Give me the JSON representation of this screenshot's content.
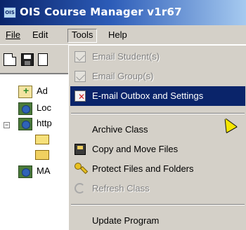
{
  "window": {
    "title": "OIS Course Manager v1r67",
    "icon": "OIS"
  },
  "menubar": {
    "items": [
      {
        "label": "File",
        "underline": "F"
      },
      {
        "label": "Edit",
        "underline": "E"
      },
      {
        "label": "Tools",
        "underline": "T"
      },
      {
        "label": "Help",
        "underline": "H"
      }
    ]
  },
  "tools_menu": {
    "items": [
      {
        "label": "Email Student(s)",
        "icon": "email-icon",
        "enabled": false
      },
      {
        "label": "Email Group(s)",
        "icon": "email-icon",
        "enabled": false
      },
      {
        "label": "E-mail Outbox and Settings",
        "icon": "outbox-icon",
        "enabled": true,
        "highlighted": true
      },
      {
        "label": "Archive Class",
        "icon": "",
        "enabled": true
      },
      {
        "label": "Copy and Move Files",
        "icon": "copy-files-icon",
        "enabled": true
      },
      {
        "label": "Protect Files and Folders",
        "icon": "key-icon",
        "enabled": true
      },
      {
        "label": "Refresh Class",
        "icon": "refresh-icon",
        "enabled": false
      },
      {
        "label": "Update Program",
        "icon": "",
        "enabled": true
      }
    ]
  },
  "tree": {
    "nodes": [
      {
        "label": "Ad"
      },
      {
        "label": "Loc"
      },
      {
        "label": "http"
      },
      {
        "label": "MA"
      }
    ]
  },
  "colors": {
    "highlight": "#0a246a",
    "titlebar_start": "#0a246a",
    "titlebar_end": "#a6caf0"
  }
}
